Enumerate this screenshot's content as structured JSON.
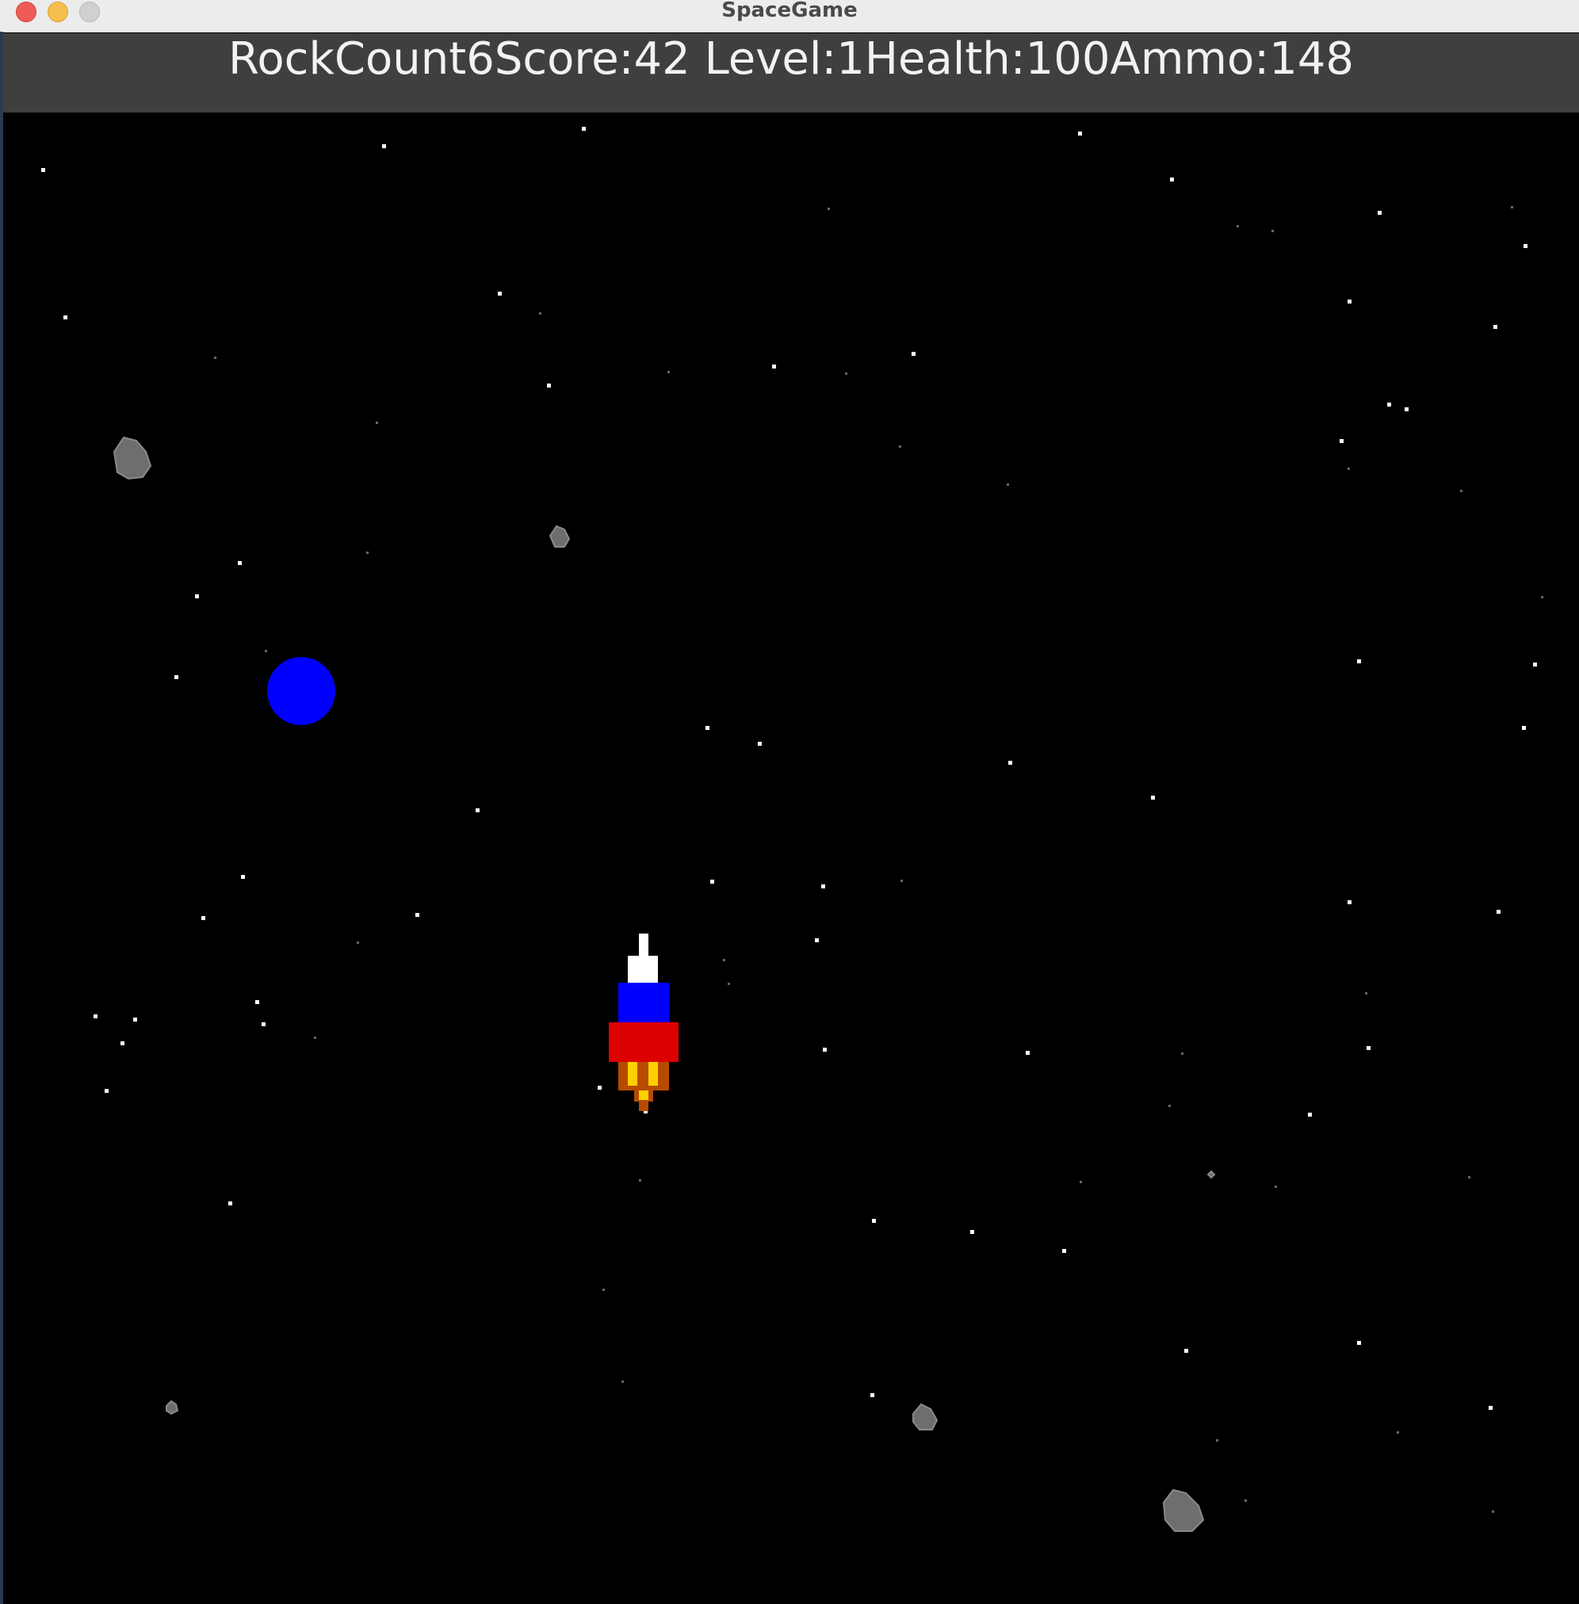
{
  "window": {
    "title": "SpaceGame",
    "controls": [
      "close",
      "minimize",
      "maximize"
    ]
  },
  "hud": {
    "text": "RockCount6Score:42 Level:1Health:100Ammo:148",
    "rock_count": 6,
    "score": 42,
    "level": 1,
    "health": 100,
    "ammo": 148
  },
  "colors": {
    "background": "#000000",
    "hud_bar": "#3f3f3f",
    "hud_text": "#f2f2f2",
    "planet": "#0000ff",
    "ship_nose": "#ffffff",
    "ship_cabin": "#0000ff",
    "ship_body": "#dd0000",
    "flame_outer": "#b84a00",
    "flame_inner": "#ffd000",
    "rock": "#6e6e6e",
    "star": "#ffffff"
  },
  "icons": {
    "ship": "rocket-ship-icon",
    "planet": "blue-planet-icon",
    "rock": "asteroid-icon"
  }
}
